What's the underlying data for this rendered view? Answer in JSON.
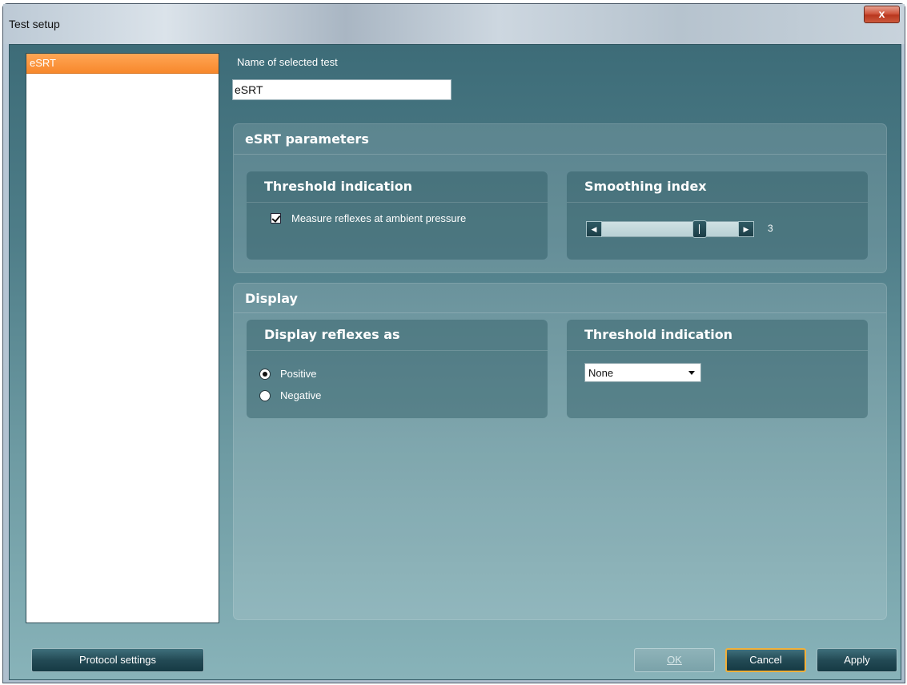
{
  "window": {
    "title": "Test setup",
    "close_label": "x"
  },
  "test_list": {
    "items": [
      {
        "label": "eSRT",
        "selected": true
      }
    ]
  },
  "name_field": {
    "label": "Name of selected test",
    "value": "eSRT"
  },
  "esrt_parameters": {
    "title": "eSRT parameters",
    "threshold_indication": {
      "title": "Threshold indication",
      "checkbox_label": "Measure reflexes at ambient pressure",
      "checked": true
    },
    "smoothing_index": {
      "title": "Smoothing index",
      "value": "3"
    }
  },
  "display": {
    "title": "Display",
    "display_reflexes_as": {
      "title": "Display reflexes as",
      "options": [
        {
          "label": "Positive",
          "selected": true
        },
        {
          "label": "Negative",
          "selected": false
        }
      ]
    },
    "threshold_indication": {
      "title": "Threshold indication",
      "selected": "None"
    }
  },
  "buttons": {
    "protocol_settings": "Protocol settings",
    "ok": "OK",
    "cancel": "Cancel",
    "apply": "Apply"
  },
  "colors": {
    "selection_orange": "#f7882c",
    "client_teal": "#4e7d88",
    "focus_border": "#f2b03a"
  }
}
